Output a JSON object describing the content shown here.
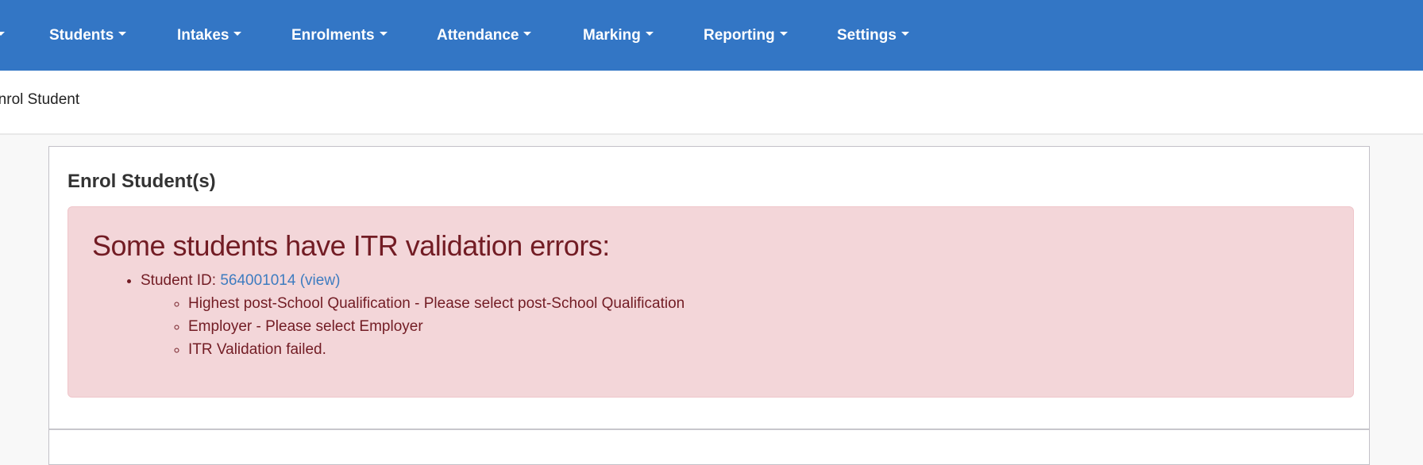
{
  "navbar": {
    "items": [
      {
        "label": "Students"
      },
      {
        "label": "Intakes"
      },
      {
        "label": "Enrolments"
      },
      {
        "label": "Attendance"
      },
      {
        "label": "Marking"
      },
      {
        "label": "Reporting"
      },
      {
        "label": "Settings"
      }
    ]
  },
  "breadcrumb": {
    "current": "Enrol Student"
  },
  "card": {
    "title": "Enrol Student(s)",
    "alert": {
      "heading": "Some students have ITR validation errors:",
      "students": [
        {
          "label": "Student ID: ",
          "id": "564001014",
          "view_label": "(view)",
          "errors": [
            "Highest post-School Qualification - Please select post-School Qualification",
            "Employer - Please select Employer",
            "ITR Validation failed."
          ]
        }
      ]
    }
  },
  "colors": {
    "navbar": "#3376c5",
    "alert_bg": "#f3d6d9",
    "alert_text": "#721c24",
    "link": "#3e7cc0"
  }
}
